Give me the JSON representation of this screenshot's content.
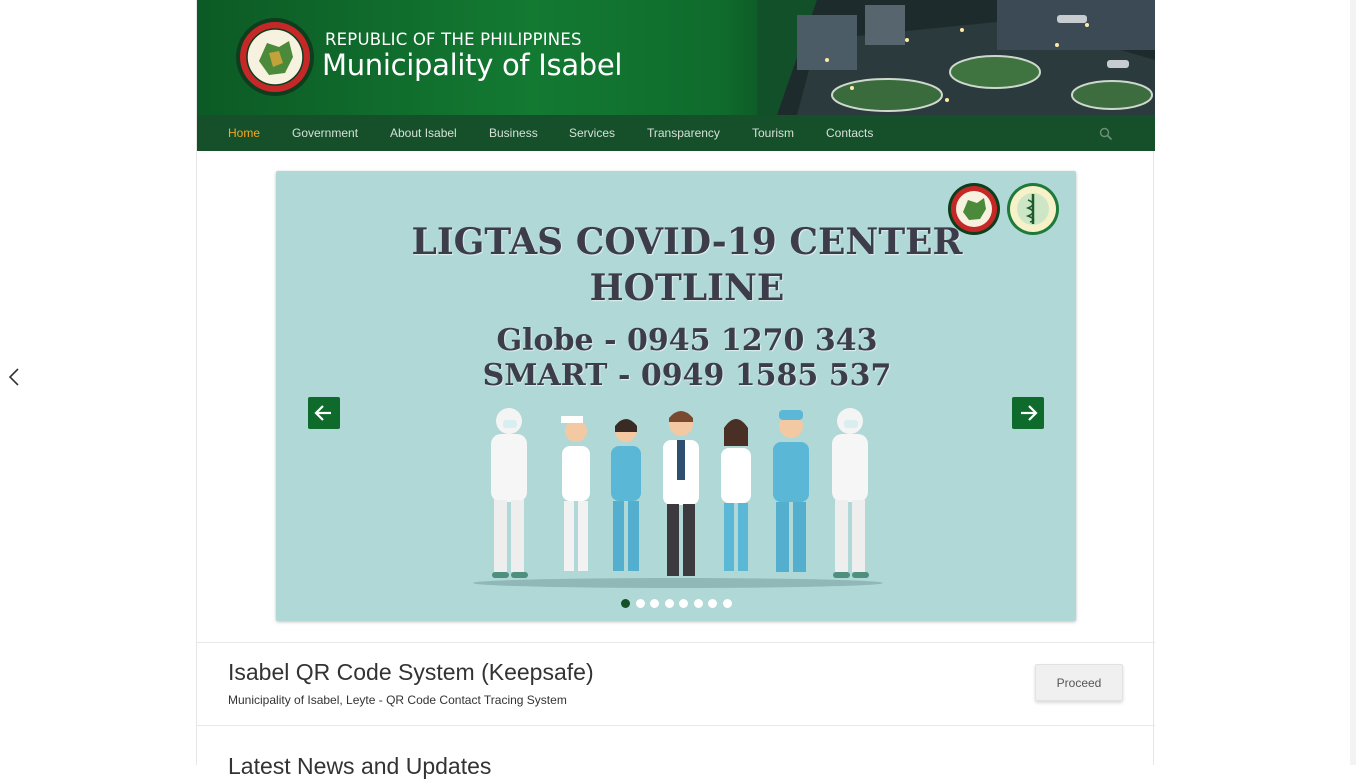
{
  "header": {
    "subtitle": "REPUBLIC OF THE PHILIPPINES",
    "title": "Municipality of Isabel"
  },
  "nav": {
    "items": [
      {
        "label": "Home",
        "active": true
      },
      {
        "label": "Government"
      },
      {
        "label": "About Isabel"
      },
      {
        "label": "Business"
      },
      {
        "label": "Services"
      },
      {
        "label": "Transparency"
      },
      {
        "label": "Tourism"
      },
      {
        "label": "Contacts"
      }
    ],
    "search_icon": "search-icon"
  },
  "slider": {
    "title_line1": "LIGTAS COVID-19 CENTER",
    "title_line2": "HOTLINE",
    "globe_line": "Globe - 0945 1270 343",
    "smart_line": "SMART - 0949 1585 537",
    "prev_icon": "arrow-left-icon",
    "next_icon": "arrow-right-icon",
    "slide_count": 8,
    "active_slide": 1,
    "background": "#b0d8d6"
  },
  "card": {
    "title": "Isabel QR Code System (Keepsafe)",
    "subtitle": "Municipality of Isabel, Leyte - QR Code Contact Tracing System",
    "button_label": "Proceed"
  },
  "next_section": {
    "heading": "Latest News and Updates"
  },
  "colors": {
    "nav_bg": "#15502b",
    "nav_active": "#f5a623",
    "accent_green": "#0f6b2c"
  }
}
